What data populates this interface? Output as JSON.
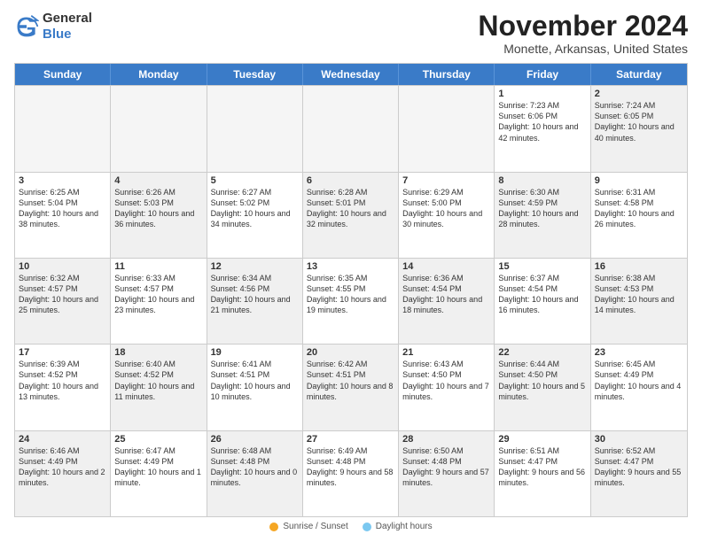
{
  "logo": {
    "general": "General",
    "blue": "Blue"
  },
  "header": {
    "title": "November 2024",
    "subtitle": "Monette, Arkansas, United States"
  },
  "days_of_week": [
    "Sunday",
    "Monday",
    "Tuesday",
    "Wednesday",
    "Thursday",
    "Friday",
    "Saturday"
  ],
  "legend": {
    "sunrise_label": "Sunrise / Sunset",
    "daylight_label": "Daylight hours"
  },
  "rows": [
    [
      {
        "day": "",
        "empty": true
      },
      {
        "day": "",
        "empty": true
      },
      {
        "day": "",
        "empty": true
      },
      {
        "day": "",
        "empty": true
      },
      {
        "day": "",
        "empty": true
      },
      {
        "day": "1",
        "info": "Sunrise: 7:23 AM\nSunset: 6:06 PM\nDaylight: 10 hours\nand 42 minutes."
      },
      {
        "day": "2",
        "info": "Sunrise: 7:24 AM\nSunset: 6:05 PM\nDaylight: 10 hours\nand 40 minutes.",
        "shaded": true
      }
    ],
    [
      {
        "day": "3",
        "info": "Sunrise: 6:25 AM\nSunset: 5:04 PM\nDaylight: 10 hours\nand 38 minutes."
      },
      {
        "day": "4",
        "info": "Sunrise: 6:26 AM\nSunset: 5:03 PM\nDaylight: 10 hours\nand 36 minutes.",
        "shaded": true
      },
      {
        "day": "5",
        "info": "Sunrise: 6:27 AM\nSunset: 5:02 PM\nDaylight: 10 hours\nand 34 minutes."
      },
      {
        "day": "6",
        "info": "Sunrise: 6:28 AM\nSunset: 5:01 PM\nDaylight: 10 hours\nand 32 minutes.",
        "shaded": true
      },
      {
        "day": "7",
        "info": "Sunrise: 6:29 AM\nSunset: 5:00 PM\nDaylight: 10 hours\nand 30 minutes."
      },
      {
        "day": "8",
        "info": "Sunrise: 6:30 AM\nSunset: 4:59 PM\nDaylight: 10 hours\nand 28 minutes.",
        "shaded": true
      },
      {
        "day": "9",
        "info": "Sunrise: 6:31 AM\nSunset: 4:58 PM\nDaylight: 10 hours\nand 26 minutes."
      }
    ],
    [
      {
        "day": "10",
        "info": "Sunrise: 6:32 AM\nSunset: 4:57 PM\nDaylight: 10 hours\nand 25 minutes.",
        "shaded": true
      },
      {
        "day": "11",
        "info": "Sunrise: 6:33 AM\nSunset: 4:57 PM\nDaylight: 10 hours\nand 23 minutes."
      },
      {
        "day": "12",
        "info": "Sunrise: 6:34 AM\nSunset: 4:56 PM\nDaylight: 10 hours\nand 21 minutes.",
        "shaded": true
      },
      {
        "day": "13",
        "info": "Sunrise: 6:35 AM\nSunset: 4:55 PM\nDaylight: 10 hours\nand 19 minutes."
      },
      {
        "day": "14",
        "info": "Sunrise: 6:36 AM\nSunset: 4:54 PM\nDaylight: 10 hours\nand 18 minutes.",
        "shaded": true
      },
      {
        "day": "15",
        "info": "Sunrise: 6:37 AM\nSunset: 4:54 PM\nDaylight: 10 hours\nand 16 minutes."
      },
      {
        "day": "16",
        "info": "Sunrise: 6:38 AM\nSunset: 4:53 PM\nDaylight: 10 hours\nand 14 minutes.",
        "shaded": true
      }
    ],
    [
      {
        "day": "17",
        "info": "Sunrise: 6:39 AM\nSunset: 4:52 PM\nDaylight: 10 hours\nand 13 minutes."
      },
      {
        "day": "18",
        "info": "Sunrise: 6:40 AM\nSunset: 4:52 PM\nDaylight: 10 hours\nand 11 minutes.",
        "shaded": true
      },
      {
        "day": "19",
        "info": "Sunrise: 6:41 AM\nSunset: 4:51 PM\nDaylight: 10 hours\nand 10 minutes."
      },
      {
        "day": "20",
        "info": "Sunrise: 6:42 AM\nSunset: 4:51 PM\nDaylight: 10 hours\nand 8 minutes.",
        "shaded": true
      },
      {
        "day": "21",
        "info": "Sunrise: 6:43 AM\nSunset: 4:50 PM\nDaylight: 10 hours\nand 7 minutes."
      },
      {
        "day": "22",
        "info": "Sunrise: 6:44 AM\nSunset: 4:50 PM\nDaylight: 10 hours\nand 5 minutes.",
        "shaded": true
      },
      {
        "day": "23",
        "info": "Sunrise: 6:45 AM\nSunset: 4:49 PM\nDaylight: 10 hours\nand 4 minutes."
      }
    ],
    [
      {
        "day": "24",
        "info": "Sunrise: 6:46 AM\nSunset: 4:49 PM\nDaylight: 10 hours\nand 2 minutes.",
        "shaded": true
      },
      {
        "day": "25",
        "info": "Sunrise: 6:47 AM\nSunset: 4:49 PM\nDaylight: 10 hours\nand 1 minute."
      },
      {
        "day": "26",
        "info": "Sunrise: 6:48 AM\nSunset: 4:48 PM\nDaylight: 10 hours\nand 0 minutes.",
        "shaded": true
      },
      {
        "day": "27",
        "info": "Sunrise: 6:49 AM\nSunset: 4:48 PM\nDaylight: 9 hours\nand 58 minutes."
      },
      {
        "day": "28",
        "info": "Sunrise: 6:50 AM\nSunset: 4:48 PM\nDaylight: 9 hours\nand 57 minutes.",
        "shaded": true
      },
      {
        "day": "29",
        "info": "Sunrise: 6:51 AM\nSunset: 4:47 PM\nDaylight: 9 hours\nand 56 minutes."
      },
      {
        "day": "30",
        "info": "Sunrise: 6:52 AM\nSunset: 4:47 PM\nDaylight: 9 hours\nand 55 minutes.",
        "shaded": true
      }
    ]
  ]
}
